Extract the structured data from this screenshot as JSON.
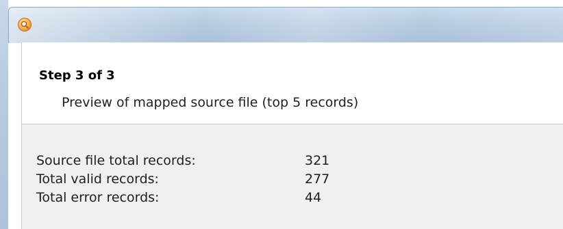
{
  "window": {
    "icon": "magnifier-app-icon"
  },
  "header": {
    "step_title": "Step 3 of 3",
    "step_description": "Preview of mapped source file (top 5 records)"
  },
  "stats": [
    {
      "label": "Source file total records:",
      "value": "321"
    },
    {
      "label": "Total valid records:",
      "value": "277"
    },
    {
      "label": "Total error records:",
      "value": "44"
    }
  ],
  "colors": {
    "titlebar": "#b6cbe1",
    "body_background": "#f0f0f0",
    "header_background": "#ffffff"
  }
}
